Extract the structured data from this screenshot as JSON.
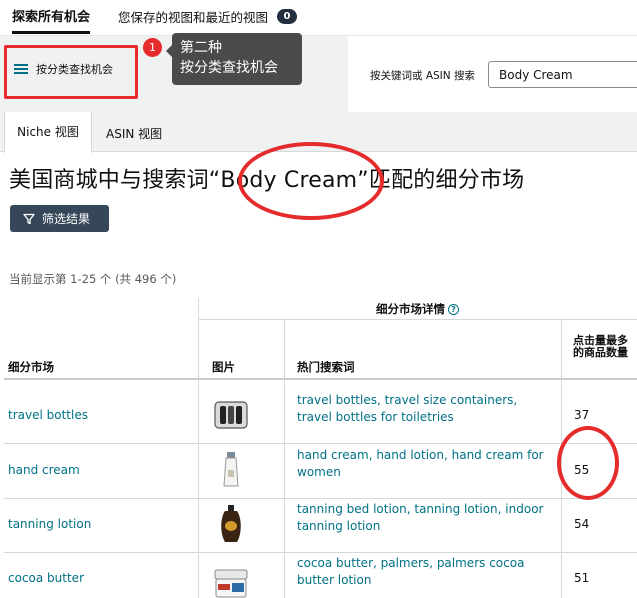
{
  "top_tabs": {
    "explore_all": "探索所有机会",
    "saved_views": "您保存的视图和最近的视图",
    "saved_count": "0"
  },
  "category": {
    "button_label": "按分类查找机会",
    "step_badge": "1",
    "tooltip_line1": "第二种",
    "tooltip_line2": "按分类查找机会"
  },
  "search": {
    "label": "按关键词或 ASIN 搜索",
    "value": "Body Cream"
  },
  "view_tabs": {
    "niche": "Niche 视图",
    "asin": "ASIN 视图"
  },
  "page": {
    "title": "美国商城中与搜索词“Body Cream”匹配的细分市场",
    "filter_label": "筛选结果",
    "shown_count": "当前显示第 1-25 个 (共 496 个)"
  },
  "table": {
    "group_header": "细分市场详情",
    "info_icon": "?",
    "col_niche": "细分市场",
    "col_image": "图片",
    "col_terms": "热门搜索词",
    "col_clicks": "点击量最多的商品数量",
    "rows": [
      {
        "niche": "travel bottles",
        "terms": "travel bottles, travel size containers, travel bottles for toiletries",
        "clicks": "37",
        "image_icon": "travel-bottle-case-icon"
      },
      {
        "niche": "hand cream",
        "terms": "hand cream, hand lotion, hand cream for women",
        "clicks": "55",
        "image_icon": "hand-cream-tube-icon"
      },
      {
        "niche": "tanning lotion",
        "terms": "tanning bed lotion, tanning lotion, indoor tanning lotion",
        "clicks": "54",
        "image_icon": "tanning-bottle-icon"
      },
      {
        "niche": "cocoa butter",
        "terms": "cocoa butter, palmers, palmers cocoa butter lotion",
        "clicks": "51",
        "image_icon": "cocoa-butter-jar-icon"
      }
    ]
  },
  "colors": {
    "link": "#007185",
    "annotation_red": "#e52b2b",
    "dark_button": "#37475a",
    "band_gray": "#f0f2f2"
  }
}
